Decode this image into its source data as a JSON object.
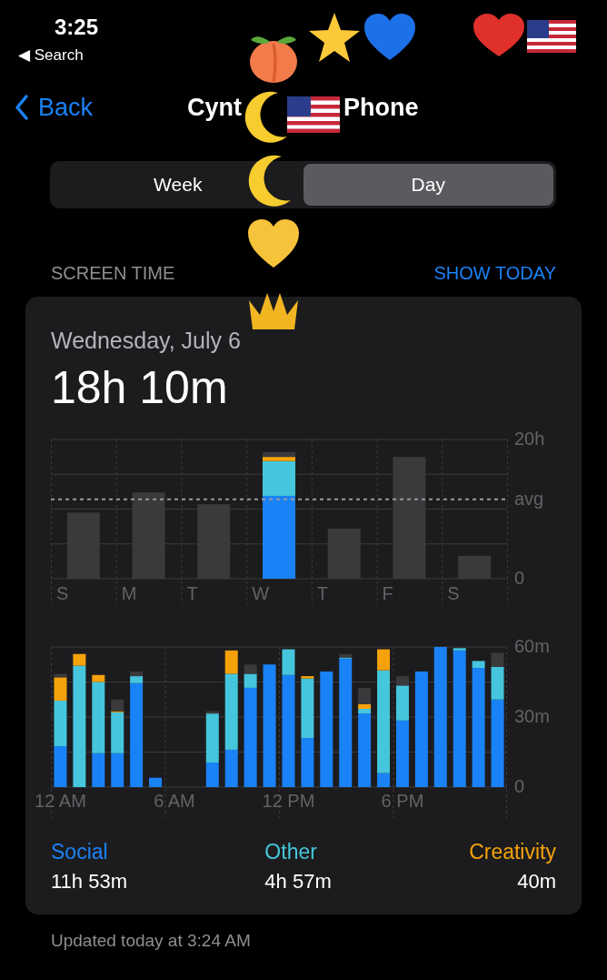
{
  "status_bar": {
    "time": "3:25",
    "back_app": "◀ Search"
  },
  "nav": {
    "back": "Back",
    "title_start": "Cynt",
    "title_end": "Phone"
  },
  "segments": [
    {
      "label": "Week",
      "selected": false
    },
    {
      "label": "Day",
      "selected": true
    }
  ],
  "section": {
    "title": "SCREEN TIME",
    "action": "SHOW TODAY"
  },
  "card": {
    "date": "Wednesday, July 6",
    "total": "18h 10m",
    "week_chart": {
      "chart_data": {
        "type": "bar",
        "stacked": true,
        "categories": [
          "S",
          "M",
          "T",
          "W",
          "T",
          "F",
          "S"
        ],
        "series": [
          {
            "color": "#1a82f7",
            "values": [
              null,
              null,
              null,
              11.9,
              null,
              null,
              null
            ]
          },
          {
            "color": "#45c6dc",
            "values": [
              null,
              null,
              null,
              5,
              null,
              null,
              null
            ]
          },
          {
            "color": "#f5a20a",
            "values": [
              null,
              null,
              null,
              0.6,
              null,
              null,
              null
            ]
          },
          {
            "color": "#3a3a3c",
            "values": [
              9.5,
              12.4,
              10.7,
              0.7,
              7.2,
              17.5,
              3.3
            ]
          }
        ],
        "ylim": [
          0,
          20
        ],
        "yticks": [
          {
            "value": 0,
            "label": "0"
          },
          {
            "value": 11.4,
            "label": "avg"
          },
          {
            "value": 20,
            "label": "20h"
          }
        ]
      }
    },
    "hour_chart": {
      "chart_data": {
        "type": "bar",
        "stacked": true,
        "categories": [
          "12 AM",
          null,
          null,
          null,
          null,
          null,
          "6 AM",
          null,
          null,
          null,
          null,
          null,
          "12 PM",
          null,
          null,
          null,
          null,
          null,
          "6 PM",
          null,
          null,
          null,
          null,
          null
        ],
        "series": [
          {
            "name": "Social",
            "color": "#1a82f7",
            "values": [
              17.5,
              0,
              14.5,
              14.5,
              44.5,
              4,
              0,
              0,
              10.5,
              16,
              42.5,
              52.5,
              48,
              21,
              49.5,
              55,
              31.5,
              6,
              28.5,
              49.5,
              60,
              58.5,
              51,
              37.5
            ]
          },
          {
            "name": "Other",
            "color": "#45c6dc",
            "values": [
              19.5,
              52,
              30.5,
              17.5,
              3,
              0,
              0,
              0,
              21,
              32.5,
              6,
              0,
              11,
              25.5,
              0,
              0.5,
              2,
              44,
              15,
              0,
              0,
              1,
              3,
              14
            ]
          },
          {
            "name": "Creativity",
            "color": "#f5a20a",
            "values": [
              10,
              5,
              3,
              0.5,
              0,
              0,
              0,
              0,
              0,
              10,
              0,
              0,
              0,
              1,
              0,
              0,
              2,
              9,
              0,
              0,
              0,
              0,
              0,
              0
            ]
          },
          {
            "color": "#3a3a3c",
            "values": [
              1.5,
              0,
              0,
              5,
              2,
              0,
              0,
              0,
              1,
              0,
              4,
              0,
              0,
              0,
              0,
              1.5,
              7,
              0,
              4,
              0,
              0,
              0,
              0,
              6
            ]
          }
        ],
        "ylim": [
          0,
          60
        ],
        "yticks": [
          {
            "value": 0,
            "label": "0"
          },
          {
            "value": 30,
            "label": "30m"
          },
          {
            "value": 60,
            "label": "60m"
          }
        ]
      }
    },
    "category_times": [
      "11h 53m",
      "4h 57m",
      "40m"
    ]
  },
  "footer": "Updated today at 3:24 AM"
}
